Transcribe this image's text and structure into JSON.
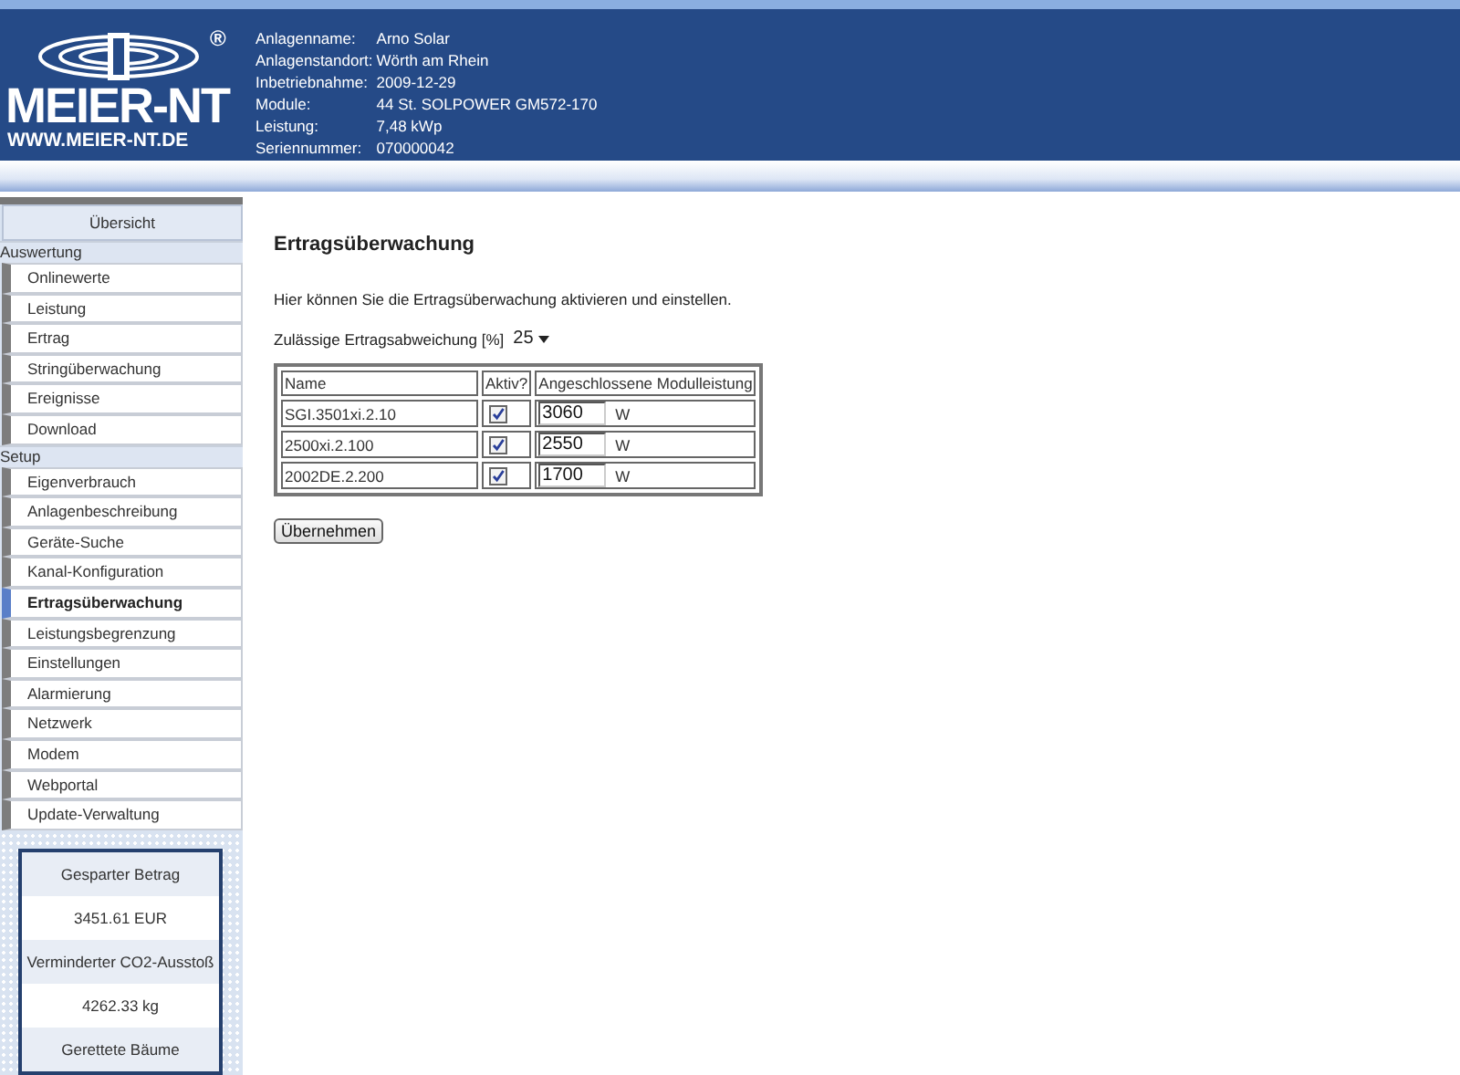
{
  "header": {
    "logo_text": "MEIER-NT",
    "logo_url": "WWW.MEIER-NT.DE",
    "registered": "®",
    "info": [
      {
        "label": "Anlagenname:",
        "value": "Arno Solar"
      },
      {
        "label": "Anlagenstandort:",
        "value": "Wörth am Rhein"
      },
      {
        "label": "Inbetriebnahme:",
        "value": "2009-12-29"
      },
      {
        "label": "Module:",
        "value": "44 St. SOLPOWER GM572-170"
      },
      {
        "label": "Leistung:",
        "value": "7,48 kWp"
      },
      {
        "label": "Seriennummer:",
        "value": "070000042"
      }
    ]
  },
  "sidebar": {
    "items": [
      {
        "kind": "top",
        "label": "Übersicht",
        "selected": false
      },
      {
        "kind": "section",
        "label": "Auswertung"
      },
      {
        "kind": "item",
        "label": "Onlinewerte",
        "selected": false
      },
      {
        "kind": "item",
        "label": "Leistung",
        "selected": false
      },
      {
        "kind": "item",
        "label": "Ertrag",
        "selected": false
      },
      {
        "kind": "item",
        "label": "Stringüberwachung",
        "selected": false
      },
      {
        "kind": "item",
        "label": "Ereignisse",
        "selected": false
      },
      {
        "kind": "item",
        "label": "Download",
        "selected": false
      },
      {
        "kind": "section",
        "label": "Setup"
      },
      {
        "kind": "item",
        "label": "Eigenverbrauch",
        "selected": false
      },
      {
        "kind": "item",
        "label": "Anlagenbeschreibung",
        "selected": false
      },
      {
        "kind": "item",
        "label": "Geräte-Suche",
        "selected": false
      },
      {
        "kind": "item",
        "label": "Kanal-Konfiguration",
        "selected": false
      },
      {
        "kind": "item",
        "label": "Ertragsüberwachung",
        "selected": true
      },
      {
        "kind": "item",
        "label": "Leistungsbegrenzung",
        "selected": false
      },
      {
        "kind": "item",
        "label": "Einstellungen",
        "selected": false
      },
      {
        "kind": "item",
        "label": "Alarmierung",
        "selected": false
      },
      {
        "kind": "item",
        "label": "Netzwerk",
        "selected": false
      },
      {
        "kind": "item",
        "label": "Modem",
        "selected": false
      },
      {
        "kind": "item",
        "label": "Webportal",
        "selected": false
      },
      {
        "kind": "item",
        "label": "Update-Verwaltung",
        "selected": false
      }
    ],
    "stats": [
      {
        "kind": "label",
        "text": "Gesparter Betrag"
      },
      {
        "kind": "value",
        "text": "3451.61 EUR"
      },
      {
        "kind": "label",
        "text": "Verminderter CO2-Ausstoß"
      },
      {
        "kind": "value",
        "text": "4262.33 kg"
      },
      {
        "kind": "label",
        "text": "Gerettete Bäume"
      }
    ]
  },
  "main": {
    "title": "Ertragsüberwachung",
    "description": "Hier können Sie die Ertragsüberwachung aktivieren und einstellen.",
    "deviation": {
      "label": "Zulässige Ertragsabweichung [%]",
      "value": "25"
    },
    "table": {
      "columns": [
        "Name",
        "Aktiv?",
        "Angeschlossene Modulleistung"
      ],
      "rows": [
        {
          "name": "SGI.3501xi.2.10",
          "checked": true,
          "power": "3060",
          "unit": "W"
        },
        {
          "name": "2500xi.2.100",
          "checked": true,
          "power": "2550",
          "unit": "W"
        },
        {
          "name": "2002DE.2.200",
          "checked": true,
          "power": "1700",
          "unit": "W"
        }
      ]
    },
    "button": "Übernehmen"
  }
}
